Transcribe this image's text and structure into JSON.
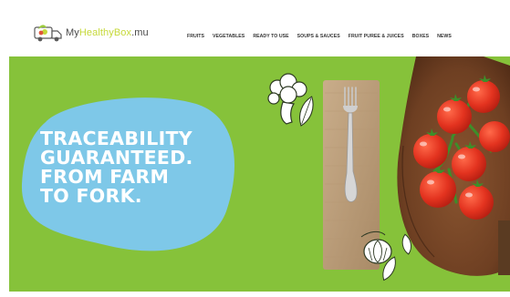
{
  "logo": {
    "prefix": "My",
    "accent": "HealthyBox",
    "suffix": ".mu",
    "icon": "delivery-truck-logo-icon"
  },
  "nav": {
    "items": [
      "FRUITS",
      "VEGETABLES",
      "READY TO USE",
      "SOUPS & SAUCES",
      "FRUIT PUREE & JUICES",
      "BOXES",
      "NEWS"
    ]
  },
  "hero": {
    "headline": [
      "TRACEABILITY",
      "GUARANTEED.",
      "FROM FARM",
      "TO FORK."
    ],
    "colors": {
      "background": "#86c23a",
      "blob": "#7ec8e8",
      "headline": "#ffffff"
    },
    "illustrations": [
      "broccoli-icon",
      "herb-leaf-icon",
      "fork-icon",
      "napkin",
      "shovel",
      "tomato-vine",
      "garlic-icon"
    ]
  }
}
